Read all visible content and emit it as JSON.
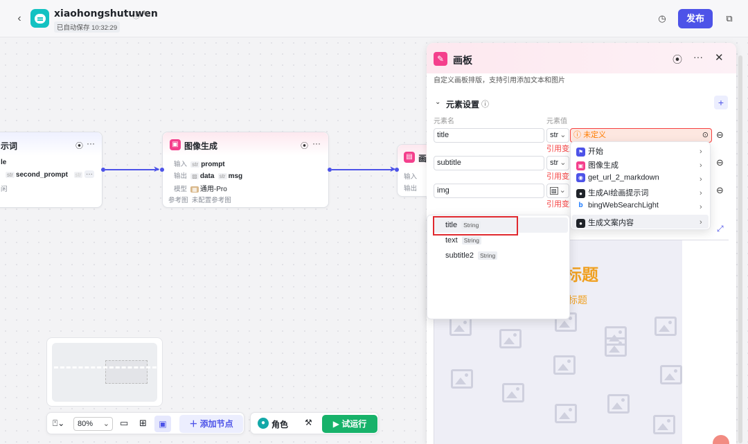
{
  "header": {
    "title": "xiaohongshutuwen",
    "saved": "已自动保存 10:32:29",
    "publish": "发布"
  },
  "nodes": {
    "prompt_node": {
      "title": "示词",
      "out_var": "second_prompt",
      "out_type": "str",
      "out_type2": "str",
      "v1": "le",
      "v2": "闲"
    },
    "image_node": {
      "title": "图像生成",
      "in_label": "输入",
      "in_type": "str",
      "in_var": "prompt",
      "out_label": "输出",
      "out_var1": "data",
      "out_type2": "str",
      "out_var2": "msg",
      "model_label": "模型",
      "model": "通用-Pro",
      "ref_label": "参考图",
      "ref_value": "未配置参考图"
    },
    "canvas_node": {
      "title": "画",
      "in_label": "输入",
      "out_label": "输出"
    }
  },
  "panel": {
    "title": "画板",
    "desc": "自定义画板排版，支持引用添加文本和图片",
    "section": "元素设置",
    "col_name": "元素名",
    "col_value": "元素值",
    "rows": [
      {
        "name": "title",
        "type": "str",
        "value": "未定义",
        "error": "引用变量"
      },
      {
        "name": "subtitle",
        "type": "str",
        "error": "引用变量"
      },
      {
        "name": "img",
        "type": "",
        "error": "引用变量"
      }
    ],
    "preview_title": "标题",
    "preview_subtitle": "标题"
  },
  "ref_menu": [
    {
      "label": "开始",
      "color": "#4d53e8",
      "icon": "flag-icon"
    },
    {
      "label": "图像生成",
      "color": "#f43f8c",
      "icon": "image-icon"
    },
    {
      "label": "get_url_2_markdown",
      "color": "#4d53e8",
      "icon": "plugin-icon"
    },
    {
      "label": "生成AI绘画提示词",
      "color": "#1f2329",
      "icon": "llm-icon"
    },
    {
      "label": "bingWebSearchLight",
      "color": "#1677ff",
      "icon": "bing-icon"
    },
    {
      "label": "生成文案内容",
      "color": "#1f2329",
      "icon": "llm-icon"
    }
  ],
  "sub_menu": [
    {
      "label": "title",
      "type": "String"
    },
    {
      "label": "text",
      "type": "String"
    },
    {
      "label": "subtitle2",
      "type": "String"
    }
  ],
  "toolbar": {
    "zoom": "80%",
    "add_node": "添加节点",
    "role": "角色",
    "run": "试运行"
  }
}
